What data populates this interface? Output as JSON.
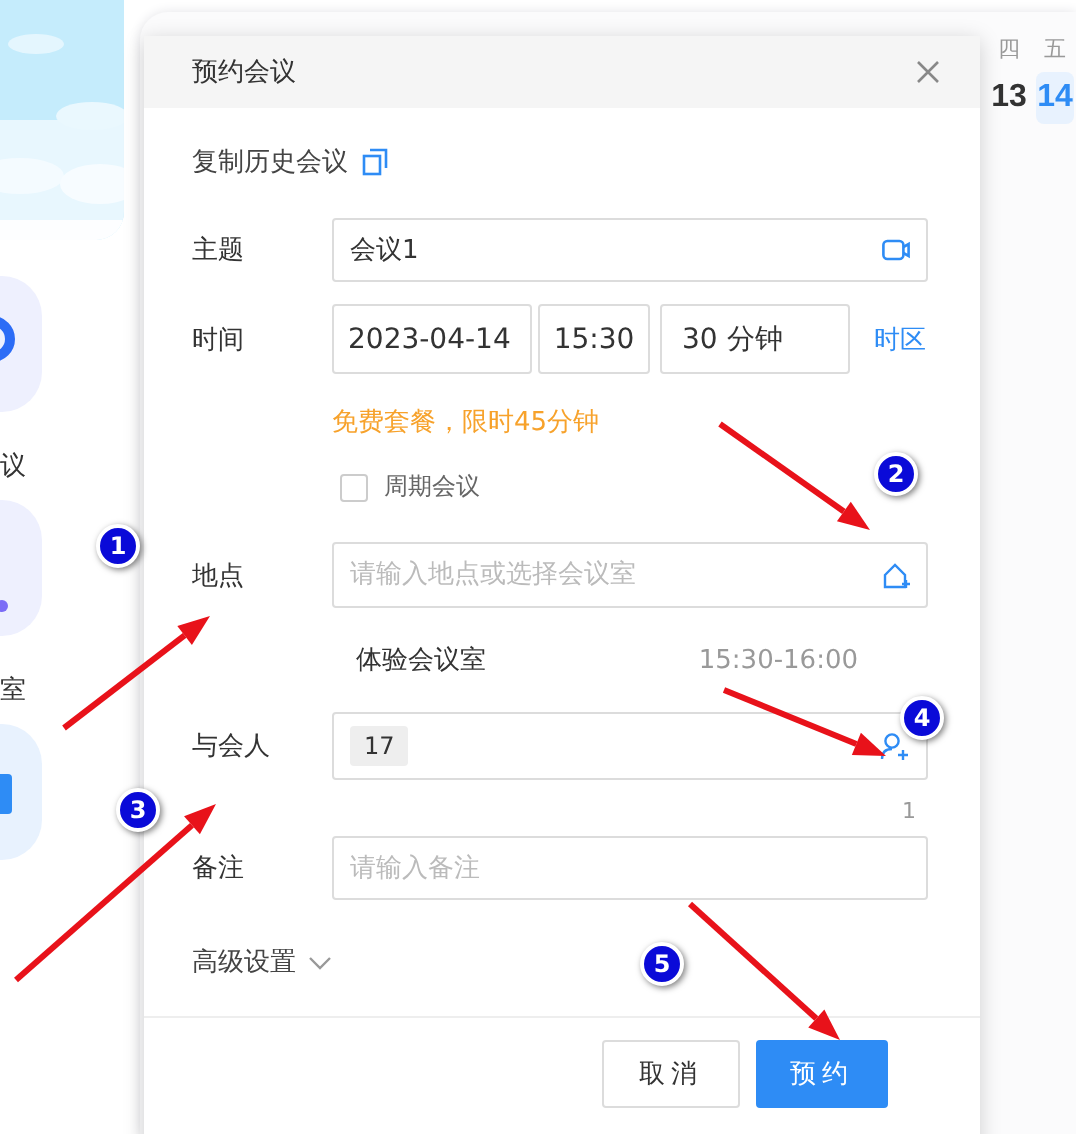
{
  "sidebar": {
    "items": [
      {
        "kind": "video",
        "label": "议"
      },
      {
        "kind": "room",
        "label": "室"
      },
      {
        "kind": "calendar"
      }
    ]
  },
  "calendar_header": {
    "days": [
      {
        "weekday": "四",
        "date": "13",
        "selected": false
      },
      {
        "weekday": "五",
        "date": "14",
        "selected": true
      }
    ]
  },
  "dialog": {
    "title": "预约会议",
    "copy_history": "复制历史会议",
    "subject": {
      "label": "主题",
      "value": "会议1"
    },
    "time": {
      "label": "时间",
      "date": "2023-04-14",
      "start": "15:30",
      "duration": "30 分钟",
      "timezone": "时区"
    },
    "notice": "免费套餐，限时45分钟",
    "recurring": {
      "label": "周期会议",
      "checked": false
    },
    "location": {
      "label": "地点",
      "placeholder": "请输入地点或选择会议室"
    },
    "room": {
      "name": "体验会议室",
      "time": "15:30-16:00"
    },
    "attendees": {
      "label": "与会人",
      "chips": [
        "17"
      ],
      "count": "1"
    },
    "notes": {
      "label": "备注",
      "placeholder": "请输入备注"
    },
    "advanced": {
      "label": "高级设置",
      "expanded": false
    },
    "buttons": [
      {
        "label": "取消",
        "kind": "secondary"
      },
      {
        "label": "预约",
        "kind": "primary"
      }
    ]
  },
  "annotations": [
    {
      "number": "1"
    },
    {
      "number": "2"
    },
    {
      "number": "3"
    },
    {
      "number": "4"
    },
    {
      "number": "5"
    }
  ]
}
